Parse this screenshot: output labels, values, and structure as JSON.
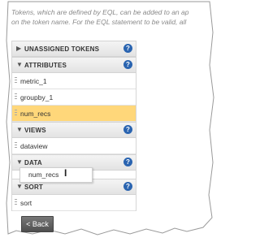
{
  "intro_text": {
    "line1": "Tokens, which are defined by EQL, can be added to an ap",
    "line2": "on the token name. For the EQL statement to be valid, all"
  },
  "sections": {
    "unassigned": {
      "title": "UNASSIGNED TOKENS",
      "arrow": "▶",
      "help": "?"
    },
    "attributes": {
      "title": "ATTRIBUTES",
      "arrow": "▼",
      "help": "?",
      "items": [
        "metric_1",
        "groupby_1",
        "num_recs"
      ]
    },
    "views": {
      "title": "VIEWS",
      "arrow": "▼",
      "help": "?",
      "items": [
        "dataview"
      ]
    },
    "data": {
      "title": "DATA",
      "arrow": "▼",
      "help": "?"
    },
    "sort": {
      "title": "SORT",
      "arrow": "▼",
      "help": "?",
      "items": [
        "sort"
      ]
    }
  },
  "dragging_item": "num_recs",
  "back_button": "< Back",
  "colors": {
    "selected": "#ffd77a",
    "help": "#2a64b0"
  }
}
